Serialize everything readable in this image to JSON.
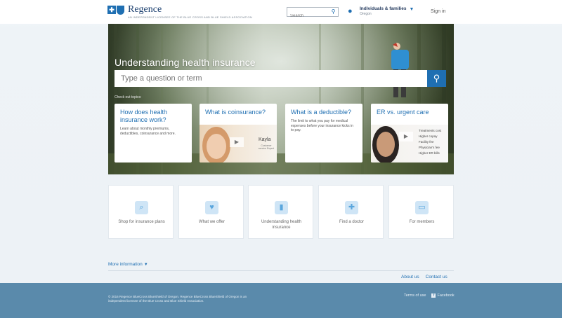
{
  "header": {
    "brand": "Regence",
    "tagline": "AN INDEPENDENT LICENSEE OF THE BLUE CROSS AND BLUE SHIELD ASSOCIATION",
    "search_placeholder": "Search",
    "user_title": "Individuals & families",
    "user_sub": "Oregon",
    "signin": "Sign in"
  },
  "hero": {
    "title": "Understanding health insurance",
    "search_placeholder": "Type a question or term",
    "caption": "Check out topics:",
    "cards": [
      {
        "title": "How does health insurance work?",
        "text": "Learn about monthly premiums, deductibles, coinsurance and more."
      },
      {
        "title": "What is coinsurance?",
        "photo_name": "Kayla",
        "photo_sub": "Customer service Expert"
      },
      {
        "title": "What is a deductible?",
        "text": "The limit to what you pay for medical expenses before your insurance kicks in to pay."
      },
      {
        "title": "ER vs. urgent care",
        "features": [
          "Treatments cost",
          "Higher copay",
          "Facility fee",
          "Physician's fee",
          "Higher ER bills"
        ]
      }
    ]
  },
  "tiles": [
    {
      "label": "Shop for insurance plans",
      "icon": "search-document-icon"
    },
    {
      "label": "What we offer",
      "icon": "heart-pulse-icon"
    },
    {
      "label": "Understanding health insurance",
      "icon": "book-icon"
    },
    {
      "label": "Find a doctor",
      "icon": "medical-bag-icon"
    },
    {
      "label": "For members",
      "icon": "monitor-icon"
    }
  ],
  "more_info": "More information",
  "links": {
    "about": "About us",
    "contact": "Contact us"
  },
  "footer": {
    "legal_1": "© 2016 Regence BlueCross BlueShield of Oregon. Regence BlueCross BlueShield of Oregon is an",
    "legal_2": "independent licensee of the Blue Cross and Blue Shield Association.",
    "terms": "Terms of use",
    "facebook": "Facebook"
  },
  "colors": {
    "brand_blue": "#1f6fb2",
    "footer": "#5a8aab"
  }
}
